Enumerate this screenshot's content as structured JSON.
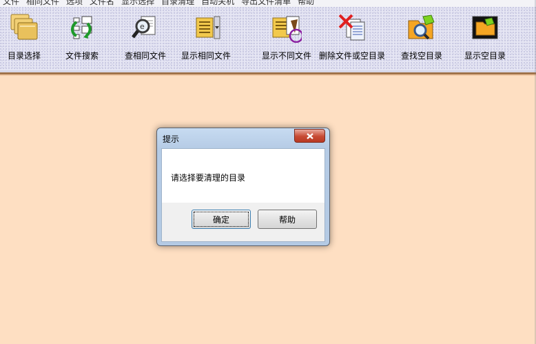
{
  "menu": [
    "文件",
    "相同文件",
    "选项",
    "文件名",
    "显示选择",
    "目录清理",
    "自动关机",
    "导出文件清单",
    "帮助"
  ],
  "toolbar": [
    {
      "label": "目录选择",
      "icon": "folder-stack-icon"
    },
    {
      "label": "文件搜索",
      "icon": "file-search-icon"
    },
    {
      "label": "查相同文件",
      "icon": "magnifier-document-icon"
    },
    {
      "label": "显示相同文件",
      "icon": "show-same-files-icon"
    },
    {
      "label": "显示不同文件",
      "icon": "show-different-files-icon"
    },
    {
      "label": "删除文件或空目录",
      "icon": "delete-files-icon"
    },
    {
      "label": "查找空目录",
      "icon": "find-empty-folder-icon"
    },
    {
      "label": "显示空目录",
      "icon": "show-empty-folder-icon"
    }
  ],
  "dialog": {
    "title": "提示",
    "message": "请选择要清理的目录",
    "ok_label": "确定",
    "help_label": "帮助"
  },
  "colors": {
    "workspace": "#fedfc2",
    "toolbar": "#e6e6f4",
    "separator": "#a1734a"
  }
}
